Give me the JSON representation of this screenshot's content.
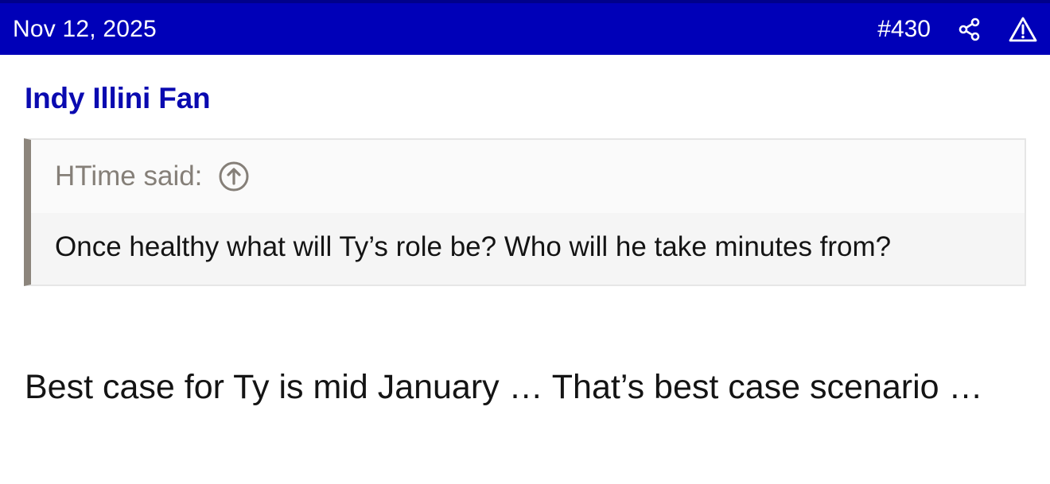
{
  "header": {
    "date": "Nov 12, 2025",
    "post_number": "#430",
    "share_icon": "share-icon",
    "report_icon": "warning-triangle-icon"
  },
  "post": {
    "author": "Indy Illini Fan",
    "quote": {
      "attribution": "HTime said:",
      "expand_icon": "arrow-up-circle-icon",
      "text": "Once healthy what will Ty’s role be? Who will he take minutes from?"
    },
    "body": "Best case for Ty is mid January … That’s best case scenario …"
  },
  "colors": {
    "header_bg": "#0000b8",
    "author_link": "#0a0ab0",
    "quote_border": "#8c857c"
  }
}
